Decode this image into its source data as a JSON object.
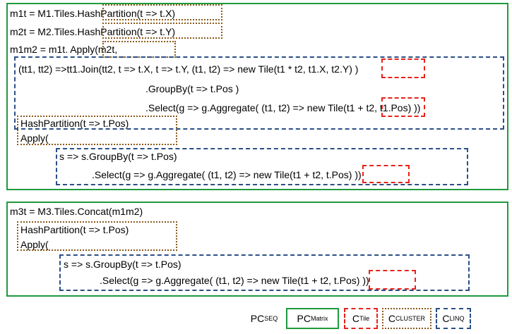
{
  "program1": {
    "line1": "m1t = M1.Tiles.HashPartition(t => t.X)",
    "line2": "m2t = M2.Tiles.HashPartition(t => t.Y)",
    "line3": "m1m2 = m1t.  Apply(m2t,",
    "linq_a": "(tt1, tt2) =>tt1.Join(tt2, t => t.X, t => t.Y, (t1, t2) => new Tile(t1 * t2, t1.X, t2.Y) )",
    "linq_b": ".GroupBy(t => t.Pos )",
    "linq_c": ".Select(g => g.Aggregate( (t1, t2) => new Tile(t1 + t2, t1.Pos) ))",
    "hash": "HashPartition(t => t.Pos)",
    "apply": "Apply(",
    "linq_d": "s => s.GroupBy(t => t.Pos)",
    "linq_e": ".Select(g => g.Aggregate( (t1, t2) => new Tile(t1 + t2, t.Pos) ))",
    "close_e": ")"
  },
  "program2": {
    "line1": "m3t = M3.Tiles.Concat(m1m2)",
    "hash": "HashPartition(t => t.Pos)",
    "apply": "Apply(",
    "linq_d": "s => s.GroupBy(t => t.Pos)",
    "linq_e": ".Select(g => g.Aggregate( (t1, t2) => new Tile(t1 + t2, t.Pos) ))",
    "close_e": ")"
  },
  "legend": {
    "pcseq": "PC",
    "pcseq_sub": "SEQ",
    "pcm": "PC",
    "pcm_sub": "Matrix",
    "ctile": "C",
    "ctile_sub": "Tile",
    "ccluster": "C",
    "ccluster_sub": "CLUSTER",
    "clinq": "C",
    "clinq_sub": "LINQ"
  },
  "colors": {
    "pc_matrix": "#1f9a3e",
    "c_tile": "#e8221b",
    "c_cluster": "#8a5a1c",
    "c_linq": "#2b4f86"
  }
}
